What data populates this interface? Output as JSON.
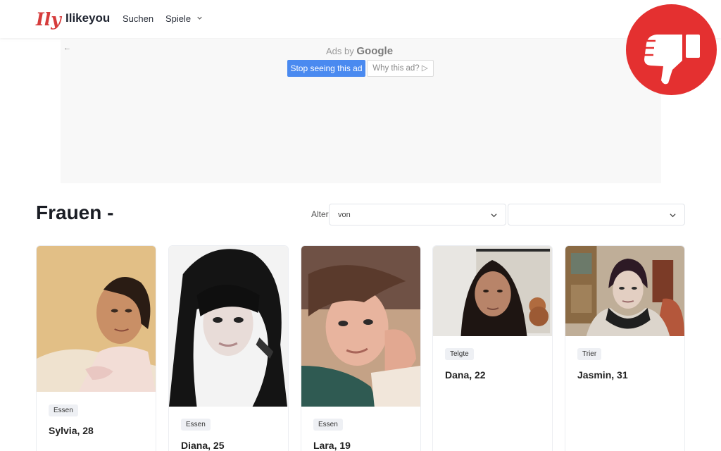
{
  "header": {
    "logo_mark": "Ily",
    "brand": "Ilikeyou",
    "nav": [
      {
        "label": "Suchen"
      },
      {
        "label": "Spiele"
      }
    ]
  },
  "ad": {
    "back": "←",
    "ads_by": "Ads by",
    "google": "Google",
    "stop_label": "Stop seeing this ad",
    "why_label": "Why this ad? ▷"
  },
  "badge": {
    "icon": "thumbs-down-icon",
    "color": "#e43030"
  },
  "main": {
    "title": "Frauen -",
    "filter_label": "Alter",
    "select_from": "von",
    "select_to": ""
  },
  "profiles": [
    {
      "tag": "Essen",
      "name": "Sylvia, 28"
    },
    {
      "tag": "Essen",
      "name": "Diana, 25"
    },
    {
      "tag": "Essen",
      "name": "Lara, 19"
    },
    {
      "tag": "Telgte",
      "name": "Dana, 22"
    },
    {
      "tag": "Trier",
      "name": "Jasmin, 31"
    }
  ],
  "colors": {
    "accent_blue": "#4a8af0",
    "logo_red": "#d63c3c",
    "badge_red": "#e43030"
  }
}
